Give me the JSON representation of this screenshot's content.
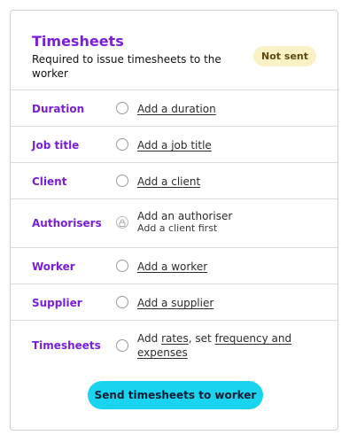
{
  "card": {
    "title": "Timesheets",
    "subtitle": "Required to issue timesheets to the worker",
    "status_badge": "Not sent"
  },
  "rows": [
    {
      "label": "Duration",
      "action": "Add a duration"
    },
    {
      "label": "Job title",
      "action": "Add a job title"
    },
    {
      "label": "Client",
      "action": "Add a client"
    },
    {
      "label": "Authorisers",
      "line1": "Add an authoriser",
      "line2": "Add a client first"
    },
    {
      "label": "Worker",
      "action": "Add a worker"
    },
    {
      "label": "Supplier",
      "action": "Add a supplier"
    },
    {
      "label": "Timesheets",
      "text_add": "Add",
      "link_rates": "rates",
      "text_set": ", set",
      "link_frequency": "frequency and",
      "link_expenses": "expenses"
    }
  ],
  "send_button": "Send timesheets to worker",
  "colors": {
    "accent": "#7a1fd6",
    "button": "#1ad3ee",
    "badge_bg": "#fbf1c7"
  }
}
